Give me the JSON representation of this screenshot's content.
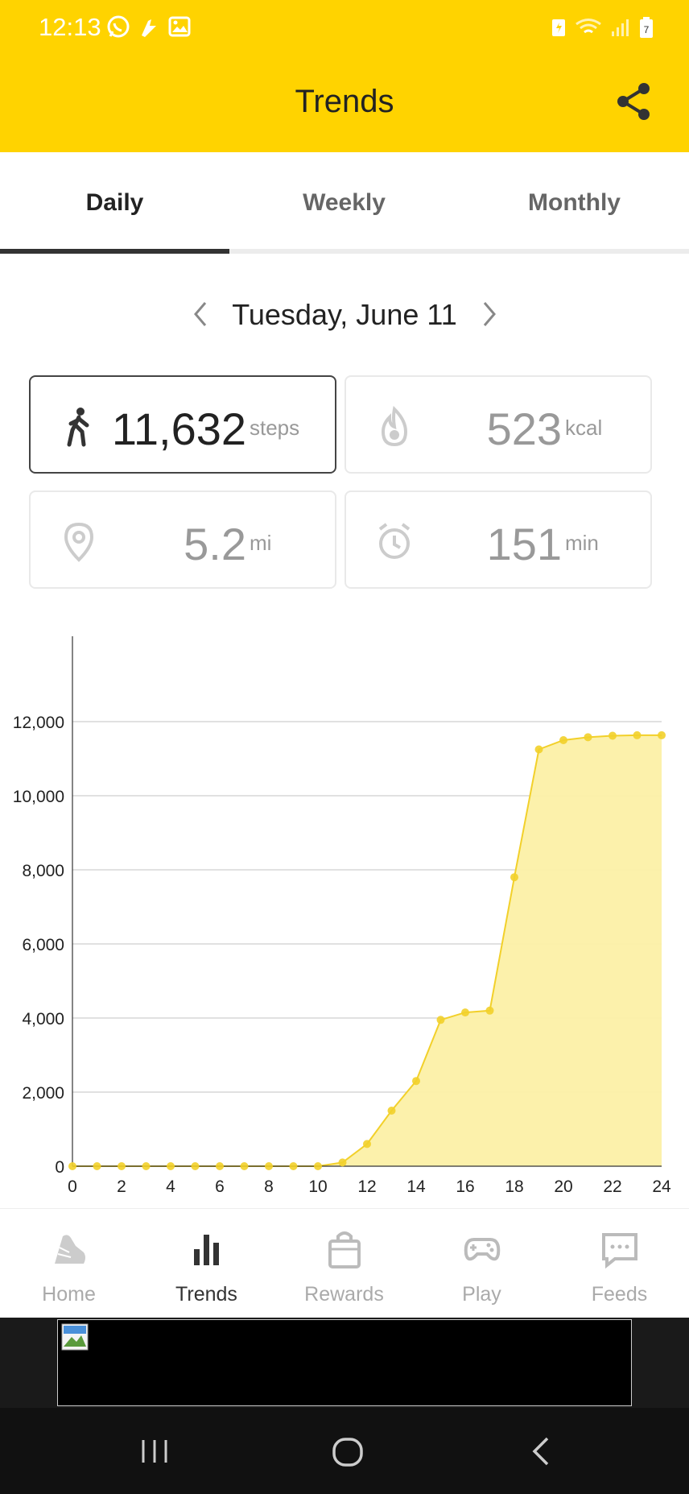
{
  "status_bar": {
    "time": "12:13",
    "left_icons": [
      "whatsapp-icon",
      "app-notification-icon",
      "gallery-icon"
    ],
    "right_icons": [
      "battery-saver-icon",
      "wifi-icon",
      "signal-icon",
      "battery-icon"
    ]
  },
  "header": {
    "title": "Trends",
    "share_icon": "share-icon",
    "background": "#FFD300"
  },
  "tabs": [
    {
      "label": "Daily",
      "active": true
    },
    {
      "label": "Weekly",
      "active": false
    },
    {
      "label": "Monthly",
      "active": false
    }
  ],
  "date_nav": {
    "date": "Tuesday, June 11",
    "prev_icon": "chevron-left-icon",
    "next_icon": "chevron-right-icon"
  },
  "stats": {
    "steps": {
      "value": "11,632",
      "unit": "steps",
      "icon": "walk-icon",
      "selected": true
    },
    "calories": {
      "value": "523",
      "unit": "kcal",
      "icon": "flame-icon"
    },
    "distance": {
      "value": "5.2",
      "unit": "mi",
      "icon": "location-pin-icon"
    },
    "active_time": {
      "value": "151",
      "unit": "min",
      "icon": "alarm-clock-icon"
    }
  },
  "chart_data": {
    "type": "area",
    "x": [
      0,
      1,
      2,
      3,
      4,
      5,
      6,
      7,
      8,
      9,
      10,
      11,
      12,
      13,
      14,
      15,
      16,
      17,
      18,
      19,
      20,
      21,
      22,
      23,
      24
    ],
    "values": [
      0,
      0,
      0,
      0,
      0,
      0,
      0,
      0,
      0,
      0,
      0,
      100,
      600,
      1500,
      2300,
      3950,
      4150,
      4200,
      7800,
      11250,
      11500,
      11580,
      11620,
      11632,
      11632
    ],
    "x_ticks": [
      "0",
      "2",
      "4",
      "6",
      "8",
      "10",
      "12",
      "14",
      "16",
      "18",
      "20",
      "22",
      "24"
    ],
    "y_ticks": [
      "0",
      "2,000",
      "4,000",
      "6,000",
      "8,000",
      "10,000",
      "12,000"
    ],
    "xlim": [
      0,
      24
    ],
    "ylim": [
      0,
      14000
    ],
    "grid": true,
    "line_color": "#F2D02A",
    "fill_color": "#FCF0A6"
  },
  "bottom_nav": [
    {
      "label": "Home",
      "icon": "shoe-icon",
      "active": false
    },
    {
      "label": "Trends",
      "icon": "bar-chart-icon",
      "active": true
    },
    {
      "label": "Rewards",
      "icon": "shopping-bag-icon",
      "active": false
    },
    {
      "label": "Play",
      "icon": "gamepad-icon",
      "active": false
    },
    {
      "label": "Feeds",
      "icon": "chat-bubble-icon",
      "active": false
    }
  ],
  "ad": {
    "icon": "broken-image-icon"
  },
  "system_nav": {
    "recents_icon": "recents-icon",
    "home_icon": "home-circle-icon",
    "back_icon": "back-chevron-icon"
  }
}
